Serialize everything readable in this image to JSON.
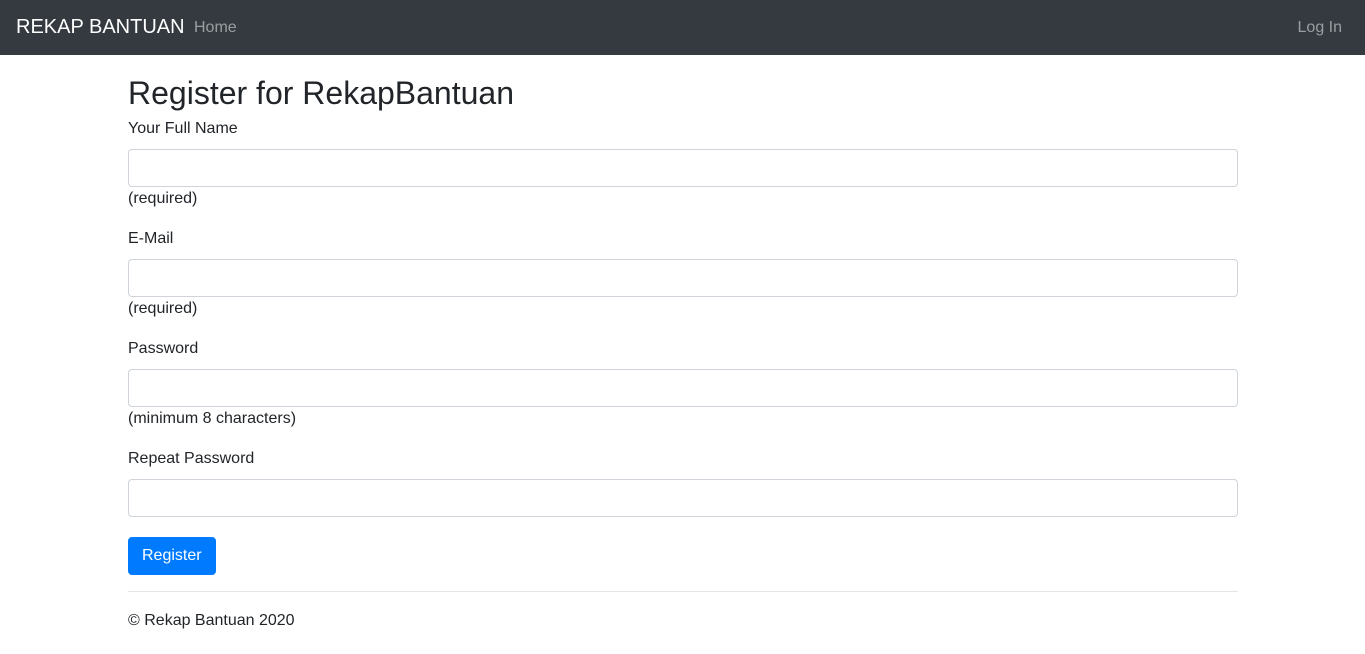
{
  "navbar": {
    "brand": "REKAP BANTUAN",
    "home_label": "Home",
    "login_label": "Log In"
  },
  "form": {
    "title": "Register for RekapBantuan",
    "full_name": {
      "label": "Your Full Name",
      "value": "",
      "hint": "(required)"
    },
    "email": {
      "label": "E-Mail",
      "value": "",
      "hint": "(required)"
    },
    "password": {
      "label": "Password",
      "value": "",
      "hint": "(minimum 8 characters)"
    },
    "repeat_password": {
      "label": "Repeat Password",
      "value": ""
    },
    "submit_label": "Register"
  },
  "footer": {
    "text": "© Rekap Bantuan 2020"
  },
  "colors": {
    "navbar_bg": "#343a40",
    "primary_button": "#007bff"
  }
}
